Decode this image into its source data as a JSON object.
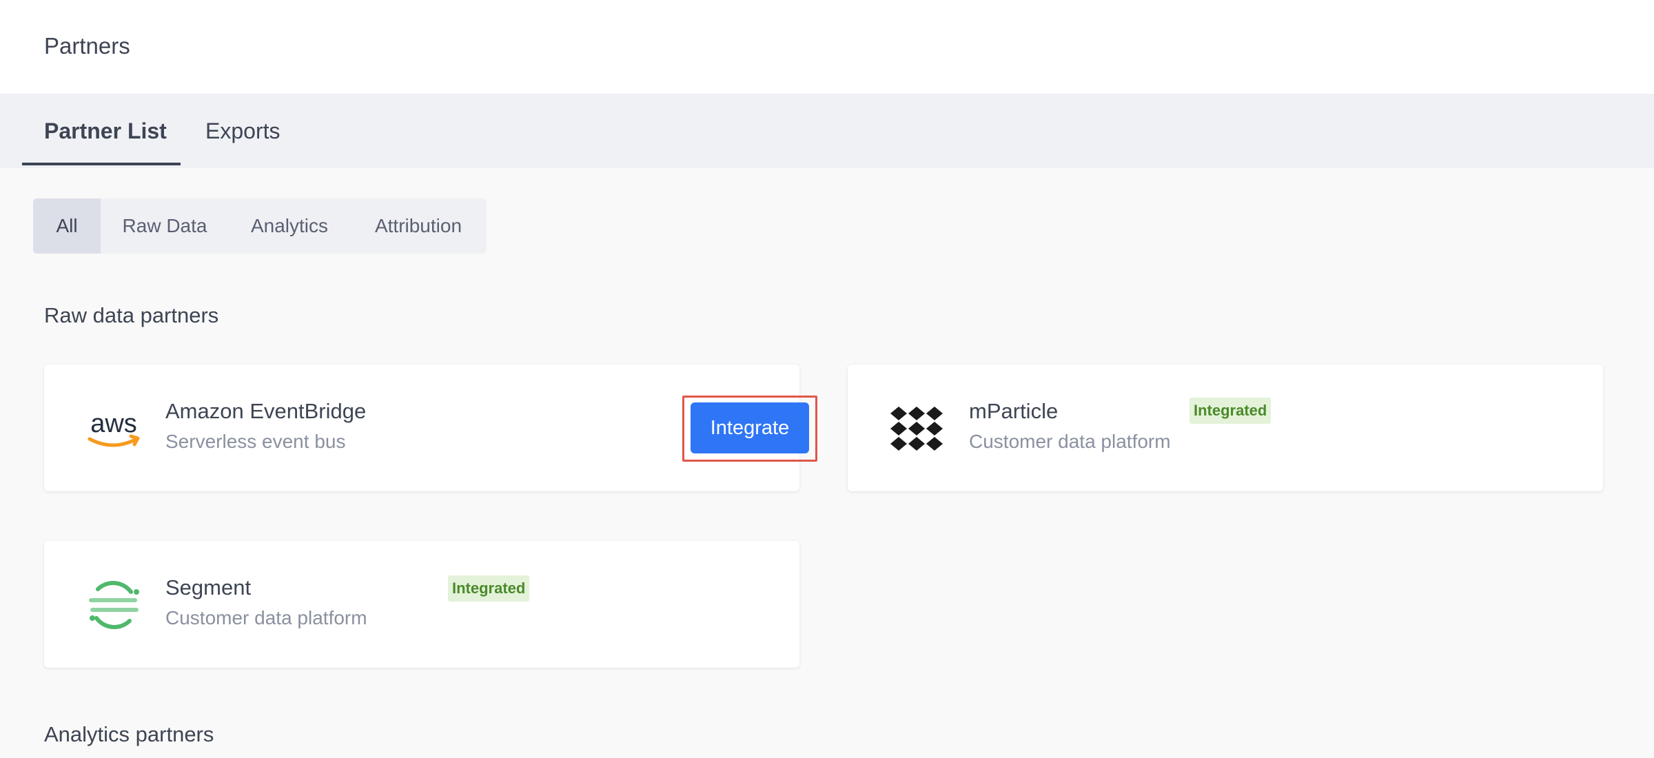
{
  "header": {
    "title": "Partners"
  },
  "tabs": [
    {
      "label": "Partner List",
      "active": true
    },
    {
      "label": "Exports",
      "active": false
    }
  ],
  "filters": [
    {
      "label": "All",
      "active": true
    },
    {
      "label": "Raw Data",
      "active": false
    },
    {
      "label": "Analytics",
      "active": false
    },
    {
      "label": "Attribution",
      "active": false
    }
  ],
  "sections": {
    "raw": {
      "title": "Raw data partners"
    },
    "analytics": {
      "title": "Analytics partners"
    }
  },
  "partners": [
    {
      "name": "Amazon EventBridge",
      "description": "Serverless event bus",
      "logo": "aws-logo",
      "action_label": "Integrate"
    },
    {
      "name": "mParticle",
      "description": "Customer data platform",
      "logo": "mparticle-logo",
      "status": "Integrated"
    },
    {
      "name": "Segment",
      "description": "Customer data platform",
      "logo": "segment-logo",
      "status": "Integrated"
    }
  ],
  "logo_text": {
    "aws": "aws"
  },
  "colors": {
    "primary": "#2f76f6",
    "badge_bg": "#e3f2d9",
    "badge_text": "#4a8a2a",
    "highlight": "#e0564a",
    "aws_orange": "#f79a1e",
    "segment_green": "#4fb86c"
  }
}
